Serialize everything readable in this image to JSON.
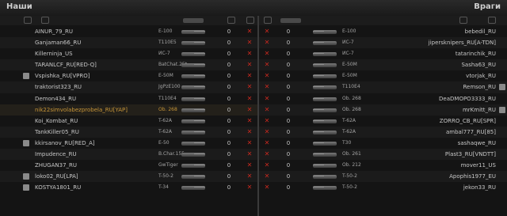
{
  "teams": {
    "left_title": "Наши",
    "right_title": "Враги"
  },
  "left_players": [
    {
      "name": "AINUR_79_RU",
      "tank": "E-100",
      "frags": "0",
      "dead": true
    },
    {
      "name": "Ganjaman66_RU",
      "tank": "T110E5",
      "frags": "0",
      "dead": true
    },
    {
      "name": "Killerninja_US",
      "tank": "ИС-7",
      "frags": "0",
      "dead": true
    },
    {
      "name": "TARANLCF_RU[RED-Q]",
      "tank": "BatChat.25t",
      "frags": "0",
      "dead": true
    },
    {
      "name": "Vspishka_RU[VPRO]",
      "tank": "E-50M",
      "frags": "0",
      "dead": true
    },
    {
      "name": "traktorist323_RU",
      "tank": "JgPzE100",
      "frags": "0",
      "dead": true
    },
    {
      "name": "Demon434_RU",
      "tank": "T110E4",
      "frags": "0",
      "dead": true
    },
    {
      "name": "nik22simvolabezprobela_RU[YAP]",
      "tank": "Ob. 268",
      "frags": "0",
      "dead": true
    },
    {
      "name": "Koi_Kombat_RU",
      "tank": "T-62A",
      "frags": "0",
      "dead": true
    },
    {
      "name": "TankKiller05_RU",
      "tank": "T-62A",
      "frags": "0",
      "dead": true
    },
    {
      "name": "kkirsanov_RU[RED_A]",
      "tank": "E-50",
      "frags": "0",
      "dead": true
    },
    {
      "name": "Impudence_RU",
      "tank": "B.Char.155",
      "frags": "0",
      "dead": true
    },
    {
      "name": "ZHUGAN37_RU",
      "tank": "GwTiger",
      "frags": "0",
      "dead": true
    },
    {
      "name": "loko02_RU[LPA]",
      "tank": "T-50-2",
      "frags": "0",
      "dead": true
    },
    {
      "name": "KOSTYA1801_RU",
      "tank": "T-34",
      "frags": "0",
      "dead": true
    }
  ],
  "right_players": [
    {
      "name": "bebedil_RU",
      "tank": "E-100",
      "frags": "0",
      "dead": true
    },
    {
      "name": "jipersknipers_RU[A-TDN]",
      "tank": "ИС-7",
      "frags": "0",
      "dead": true
    },
    {
      "name": "tatarinchik_RU",
      "tank": "ИС-7",
      "frags": "0",
      "dead": true
    },
    {
      "name": "Sasha63_RU",
      "tank": "E-50M",
      "frags": "0",
      "dead": true
    },
    {
      "name": "vtorjak_RU",
      "tank": "E-50M",
      "frags": "0",
      "dead": true
    },
    {
      "name": "Remson_RU",
      "tank": "T110E4",
      "frags": "0",
      "dead": true
    },
    {
      "name": "DeaDMOPO3333_RU",
      "tank": "Ob. 268",
      "frags": "0",
      "dead": true
    },
    {
      "name": "mrKmitt_RU",
      "tank": "Ob. 268",
      "frags": "0",
      "dead": true
    },
    {
      "name": "ZORRO_CB_RU[SPR]",
      "tank": "T-62A",
      "frags": "0",
      "dead": true
    },
    {
      "name": "ambal777_RU[85]",
      "tank": "T-62A",
      "frags": "0",
      "dead": true
    },
    {
      "name": "sashaqwe_RU",
      "tank": "T30",
      "frags": "0",
      "dead": true
    },
    {
      "name": "Plast3_RU[VNDTT]",
      "tank": "Ob. 261",
      "frags": "0",
      "dead": true
    },
    {
      "name": "mover11_US",
      "tank": "Ob. 212",
      "frags": "0",
      "dead": true
    },
    {
      "name": "Apophis1977_EU",
      "tank": "T-50-2",
      "frags": "0",
      "dead": true
    },
    {
      "name": "jekon33_RU",
      "tank": "T-50-2",
      "frags": "0",
      "dead": true
    }
  ],
  "colors": {
    "dead_mark": "#c8281e",
    "highlight_player": "#c79538"
  }
}
